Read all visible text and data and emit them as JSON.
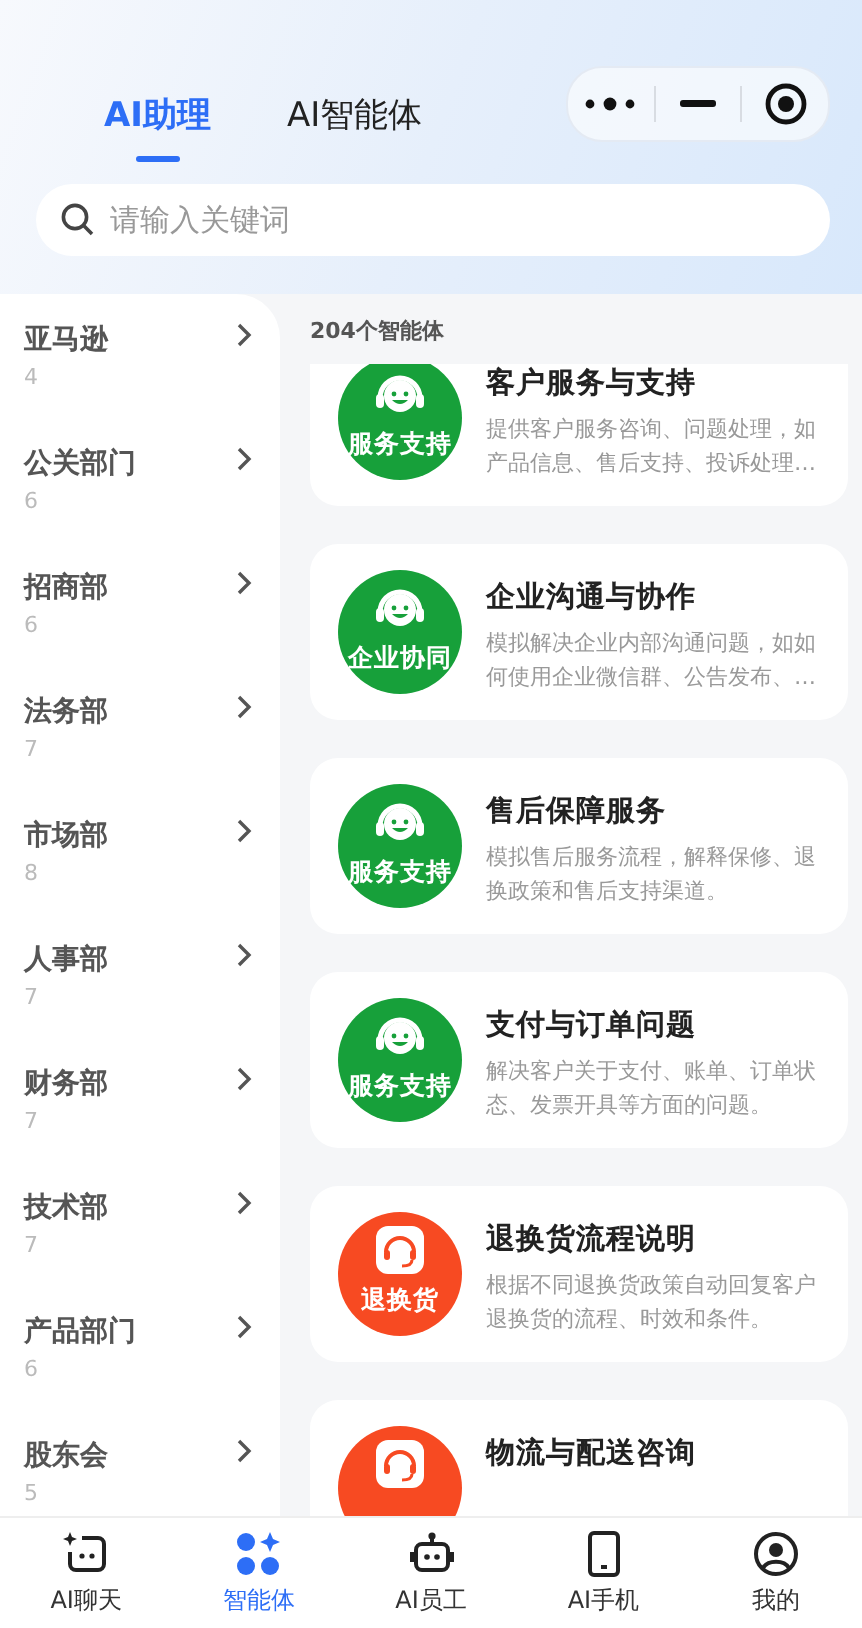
{
  "tabs": [
    {
      "label": "AI助理",
      "selected": true
    },
    {
      "label": "AI智能体",
      "selected": false
    }
  ],
  "search": {
    "placeholder": "请输入关键词"
  },
  "sidebar": {
    "items": [
      {
        "name": "亚马逊",
        "count": "4"
      },
      {
        "name": "公关部门",
        "count": "6"
      },
      {
        "name": "招商部",
        "count": "6"
      },
      {
        "name": "法务部",
        "count": "7"
      },
      {
        "name": "市场部",
        "count": "8"
      },
      {
        "name": "人事部",
        "count": "7"
      },
      {
        "name": "财务部",
        "count": "7"
      },
      {
        "name": "技术部",
        "count": "7"
      },
      {
        "name": "产品部门",
        "count": "6"
      },
      {
        "name": "股东会",
        "count": "5"
      }
    ]
  },
  "agent_count": "204个智能体",
  "agents": [
    {
      "title": "客户服务与支持",
      "description": "提供客户服务咨询、问题处理，如产品信息、售后支持、投诉处理…",
      "badge": "服务支持",
      "kind": "headset",
      "color": "#17a03a"
    },
    {
      "title": "企业沟通与协作",
      "description": "模拟解决企业内部沟通问题，如如何使用企业微信群、公告发布、…",
      "badge": "企业协同",
      "kind": "headset",
      "color": "#17a03a"
    },
    {
      "title": "售后保障服务",
      "description": "模拟售后服务流程，解释保修、退换政策和售后支持渠道。",
      "badge": "服务支持",
      "kind": "headset",
      "color": "#17a03a"
    },
    {
      "title": "支付与订单问题",
      "description": "解决客户关于支付、账单、订单状态、发票开具等方面的问题。",
      "badge": "服务支持",
      "kind": "headset",
      "color": "#17a03a"
    },
    {
      "title": "退换货流程说明",
      "description": "根据不同退换货政策自动回复客户退换货的流程、时效和条件。",
      "badge": "退换货",
      "kind": "bot",
      "color": "#f74a22"
    },
    {
      "title": "物流与配送咨询",
      "kind": "bot",
      "color": "#f74a22"
    }
  ],
  "bottom_nav": [
    {
      "label": "AI聊天",
      "kind": "chat",
      "selected": false
    },
    {
      "label": "智能体",
      "kind": "agents",
      "selected": true
    },
    {
      "label": "AI员工",
      "kind": "robot",
      "selected": false
    },
    {
      "label": "AI手机",
      "kind": "phone",
      "selected": false
    },
    {
      "label": "我的",
      "kind": "profile",
      "selected": false
    }
  ]
}
